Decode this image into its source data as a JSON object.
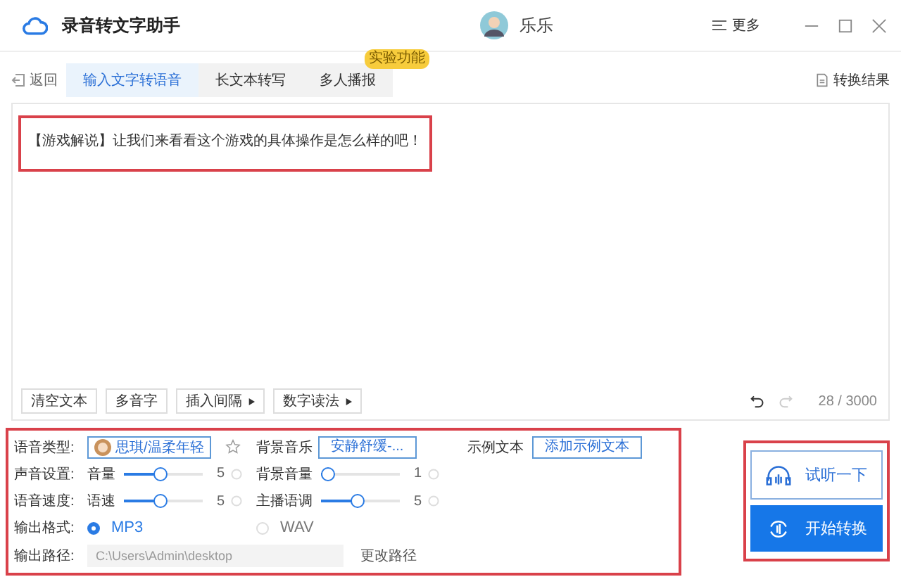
{
  "window": {
    "title": "录音转文字助手",
    "user": "乐乐",
    "menu": "更多"
  },
  "nav": {
    "back": "返回",
    "tabs": [
      {
        "label": "输入文字转语音",
        "selected": true
      },
      {
        "label": "长文本转写",
        "selected": false
      },
      {
        "label": "多人播报",
        "selected": false,
        "badge": "实验功能"
      }
    ],
    "results": "转换结果"
  },
  "editor": {
    "text": "【游戏解说】让我们来看看这个游戏的具体操作是怎么样的吧！",
    "tools": [
      {
        "label": "清空文本",
        "menu": false
      },
      {
        "label": "多音字",
        "menu": false
      },
      {
        "label": "插入间隔",
        "menu": true
      },
      {
        "label": "数字读法",
        "menu": true
      }
    ],
    "counter": "28 / 3000"
  },
  "settings": {
    "voice": {
      "label": "语音类型:",
      "value": "思琪/温柔年轻"
    },
    "bg_music": {
      "label": "背景音乐",
      "value": "安静舒缓-..."
    },
    "sample": {
      "label": "示例文本",
      "button": "添加示例文本"
    },
    "slider_rows": [
      {
        "label": "声音设置:",
        "sliders": [
          {
            "name": "音量",
            "level": 0.45,
            "reading": "5"
          },
          {
            "name": "背景音量",
            "level": 0,
            "reading": "1"
          }
        ]
      },
      {
        "label": "语音速度:",
        "sliders": [
          {
            "name": "语速",
            "level": 0.45,
            "reading": "5"
          },
          {
            "name": "主播语调",
            "level": 0.45,
            "reading": "5"
          }
        ]
      }
    ],
    "format": {
      "label": "输出格式:",
      "options": [
        {
          "label": "MP3",
          "selected": true
        },
        {
          "label": "WAV",
          "selected": false
        }
      ]
    },
    "path": {
      "label": "输出路径:",
      "value": "C:\\Users\\Admin\\desktop",
      "button": "更改路径"
    }
  },
  "actions": {
    "preview": "试听一下",
    "convert": "开始转换"
  }
}
